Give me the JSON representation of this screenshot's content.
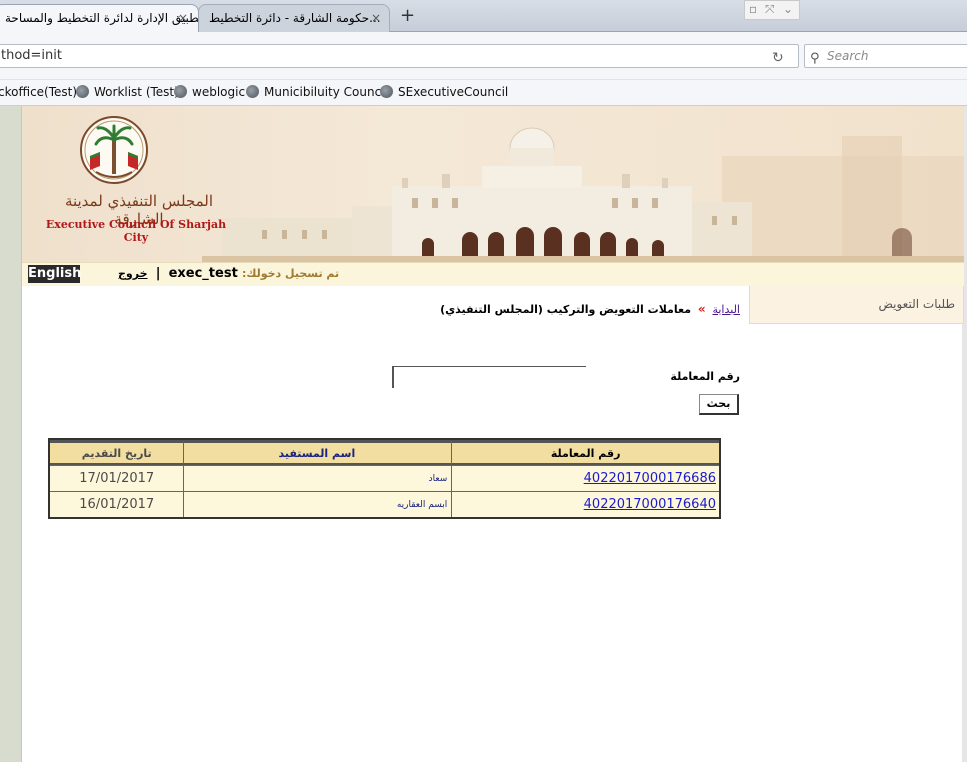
{
  "browser": {
    "tabs": [
      {
        "title": "تطبيق الإدارة لدائرة التخطيط والمساحة",
        "active": true
      },
      {
        "title": "حكومة الشارقة - دائرة التخطيط...",
        "active": false
      }
    ],
    "new_tab": "+",
    "close_glyph": "×",
    "url": "thod=init",
    "search_placeholder": "Search",
    "bookmarks": [
      "ckoffice(Test)",
      "Worklist (Test)",
      "weblogic",
      "Municibiluity Council",
      "SExecutiveCouncil"
    ]
  },
  "header": {
    "council_name_ar": "المجلس التنفيذي لمدينة الشارقة",
    "council_name_en": "Executive Council Of Sharjah City",
    "colors": {
      "banner": "#f1e2cc",
      "accent_red": "#b01818"
    }
  },
  "user_bar": {
    "language_button": "English",
    "logout": "خروج",
    "separator": "|",
    "username": "exec_test",
    "logged_in_label": "تم تسجيل دخولك:"
  },
  "side_tab": {
    "label": "طلبات التعويض"
  },
  "breadcrumb": {
    "home": "البداية",
    "arrow": "»",
    "current": "معاملات التعويض والتركيب (المجلس التنفيذي)"
  },
  "search_form": {
    "label": "رقم المعاملة",
    "value": "",
    "button": "بحث"
  },
  "table": {
    "headers": {
      "number": "رقم المعاملة",
      "name": "اسم المستفيد",
      "date": "تاريخ التقديم"
    },
    "rows": [
      {
        "number": "4022017000176686",
        "name": "سعاد",
        "date": "17/01/2017"
      },
      {
        "number": "4022017000176640",
        "name": "ابسم العقاريه",
        "date": "16/01/2017"
      }
    ]
  }
}
